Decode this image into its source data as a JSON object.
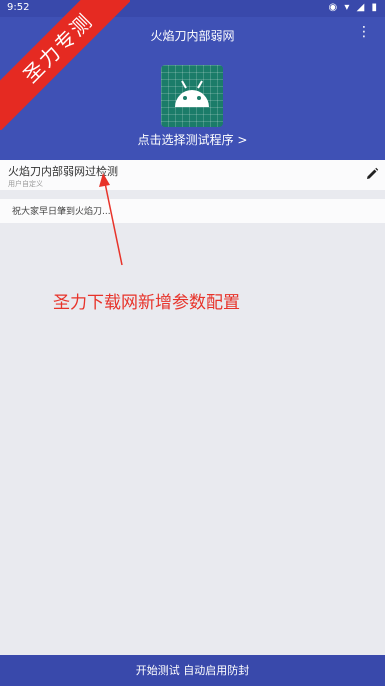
{
  "status_bar": {
    "time": "9:52",
    "icons": "◉ ▾ ◢ ▮"
  },
  "app_bar": {
    "title": "火焰刀内部弱网",
    "menu_icon": "⋮"
  },
  "program": {
    "select_label": "点击选择测试程序 >"
  },
  "config_card": {
    "title": "火焰刀内部弱网过检测",
    "subtitle": "用户自定义"
  },
  "notice_card": {
    "text": "祝大家早日肇到火焰刀..."
  },
  "annotation": {
    "text": "圣力下载网新增参数配置"
  },
  "watermark": {
    "text": "圣力专测"
  },
  "bottom_bar": {
    "label": "开始测试 自动启用防封"
  },
  "colors": {
    "primary": "#3f51b5",
    "accent_red": "#e8332a",
    "tile": "#1b7c69"
  }
}
